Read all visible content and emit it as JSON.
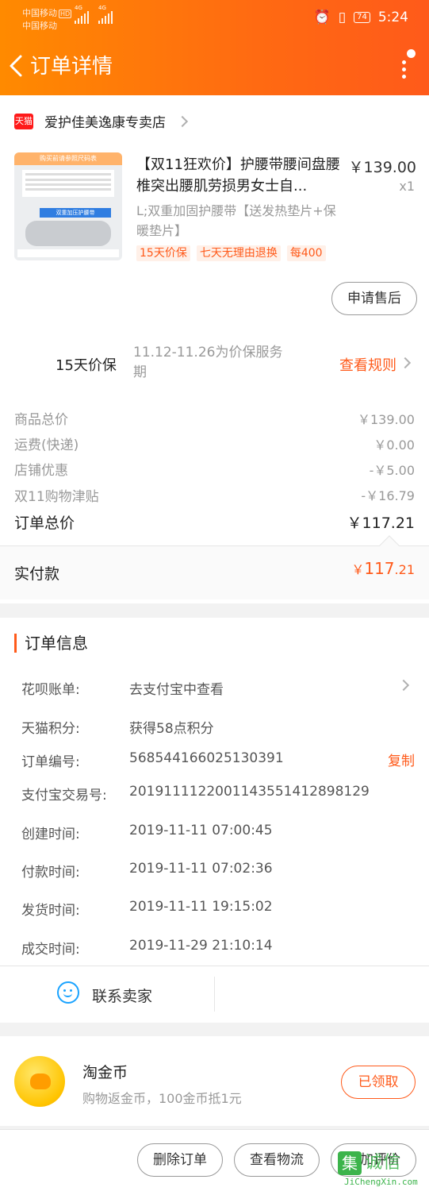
{
  "status_bar": {
    "carrier1": "中国移动",
    "carrier1_badge": "HD",
    "carrier2": "中国移动",
    "net1": "4G",
    "net2": "4G",
    "battery": "74",
    "time": "5:24"
  },
  "header": {
    "title": "订单详情"
  },
  "shop": {
    "badge": "天猫",
    "name": "爱护佳美逸康专卖店"
  },
  "product": {
    "thumb_caption": "购买前请参照尺码表",
    "thumb_band_label": "双重加压护腰带",
    "title": "【双11狂欢价】护腰带腰间盘腰椎突出腰肌劳损男女士自...",
    "price": "￥139.00",
    "qty": "x1",
    "sku": "L;双重加固护腰带【送发热垫片+保暖垫片】",
    "tags": [
      "15天价保",
      "七天无理由退换",
      "每400"
    ],
    "after_sale_button": "申请售后"
  },
  "price_guarantee": {
    "label": "15天价保",
    "desc": "11.12-11.26为价保服务期",
    "link": "查看规则"
  },
  "costs": [
    {
      "label": "商品总价",
      "value": "￥139.00"
    },
    {
      "label": "运费(快递)",
      "value": "￥0.00"
    },
    {
      "label": "店铺优惠",
      "value": "-￥5.00"
    },
    {
      "label": "双11购物津贴",
      "value": "-￥16.79"
    }
  ],
  "total": {
    "label": "订单总价",
    "value": "￥117.21"
  },
  "paid": {
    "label": "实付款",
    "currency": "￥",
    "integer": "117",
    "decimal": ".21"
  },
  "order_info": {
    "title": "订单信息",
    "rows": [
      {
        "label": "花呗账单:",
        "value": "去支付宝中查看"
      },
      {
        "label": "天猫积分:",
        "value": "获得58点积分"
      },
      {
        "label": "订单编号:",
        "value": "568544166025130391"
      },
      {
        "label": "支付宝交易号:",
        "value": "2019111122001143551412898129"
      },
      {
        "label": "创建时间:",
        "value": "2019-11-11 07:00:45"
      },
      {
        "label": "付款时间:",
        "value": "2019-11-11 07:02:36"
      },
      {
        "label": "发货时间:",
        "value": "2019-11-11 19:15:02"
      },
      {
        "label": "成交时间:",
        "value": "2019-11-29 21:10:14"
      }
    ],
    "copy_label": "复制"
  },
  "contact": {
    "label": "联系卖家"
  },
  "coins": {
    "title": "淘金币",
    "desc": "购物返金币，100金币抵1元",
    "button": "已领取"
  },
  "bottom_bar": {
    "buttons": [
      "删除订单",
      "查看物流",
      "追加评价"
    ]
  },
  "watermark": {
    "glyph": "集",
    "text": "诚信",
    "sub": "JiChengXin.com"
  },
  "colors": {
    "accent": "#ff5a1a",
    "header_start": "#ff8a00",
    "header_end": "#ff5a1a",
    "tmall_red": "#ff1a1a",
    "contact_blue": "#1aa3ff"
  }
}
